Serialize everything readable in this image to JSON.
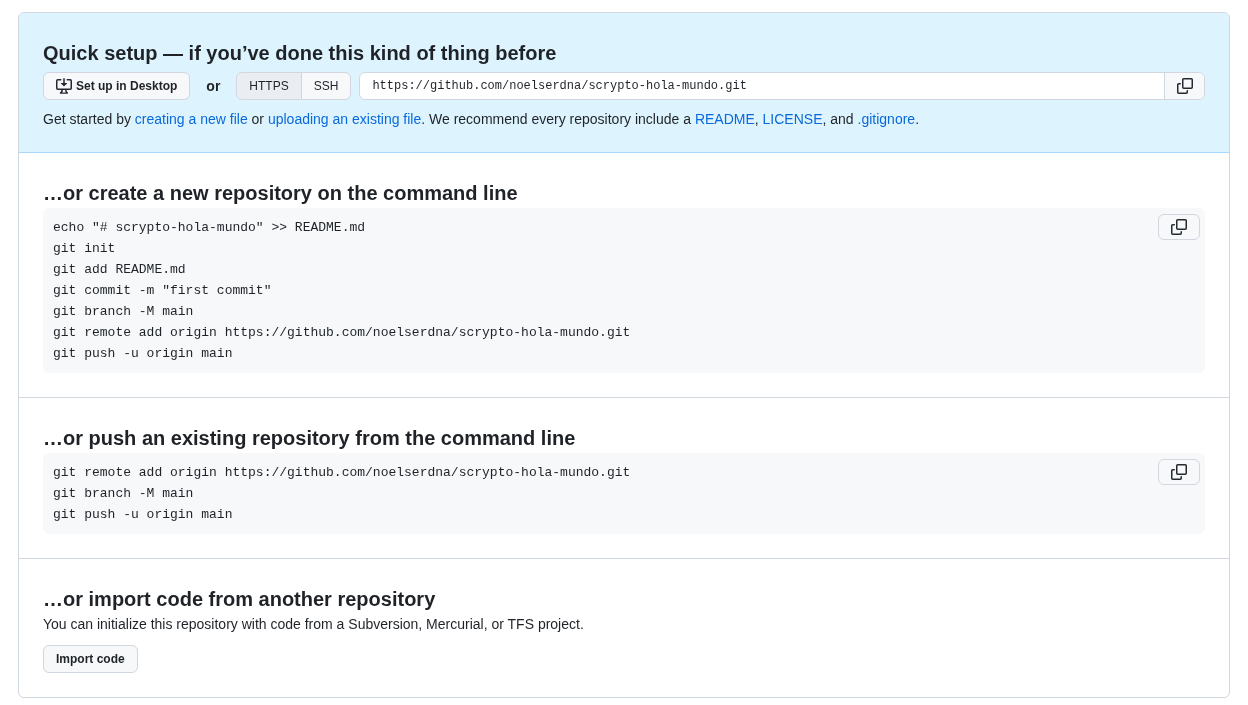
{
  "quick_setup": {
    "title": "Quick setup — if you’ve done this kind of thing before",
    "desktop_button": "Set up in Desktop",
    "or_label": "or",
    "protocols": [
      {
        "label": "HTTPS",
        "selected": true
      },
      {
        "label": "SSH",
        "selected": false
      }
    ],
    "clone_url": "https://github.com/noelserdna/scrypto-hola-mundo.git",
    "help": [
      {
        "kind": "text",
        "text": "Get started by "
      },
      {
        "kind": "link",
        "text": "creating a new file"
      },
      {
        "kind": "text",
        "text": " or "
      },
      {
        "kind": "link",
        "text": "uploading an existing file"
      },
      {
        "kind": "text",
        "text": ". We recommend every repository include a "
      },
      {
        "kind": "link",
        "text": "README"
      },
      {
        "kind": "text",
        "text": ", "
      },
      {
        "kind": "link",
        "text": "LICENSE"
      },
      {
        "kind": "text",
        "text": ", and "
      },
      {
        "kind": "link",
        "text": ".gitignore"
      },
      {
        "kind": "text",
        "text": "."
      }
    ]
  },
  "command_sections": [
    {
      "title": "…or create a new repository on the command line",
      "lines": [
        "echo \"# scrypto-hola-mundo\" >> README.md",
        "git init",
        "git add README.md",
        "git commit -m \"first commit\"",
        "git branch -M main",
        "git remote add origin https://github.com/noelserdna/scrypto-hola-mundo.git",
        "git push -u origin main"
      ]
    },
    {
      "title": "…or push an existing repository from the command line",
      "lines": [
        "git remote add origin https://github.com/noelserdna/scrypto-hola-mundo.git",
        "git branch -M main",
        "git push -u origin main"
      ]
    }
  ],
  "import_section": {
    "title": "…or import code from another repository",
    "description": "You can initialize this repository with code from a Subversion, Mercurial, or TFS project.",
    "button": "Import code"
  }
}
